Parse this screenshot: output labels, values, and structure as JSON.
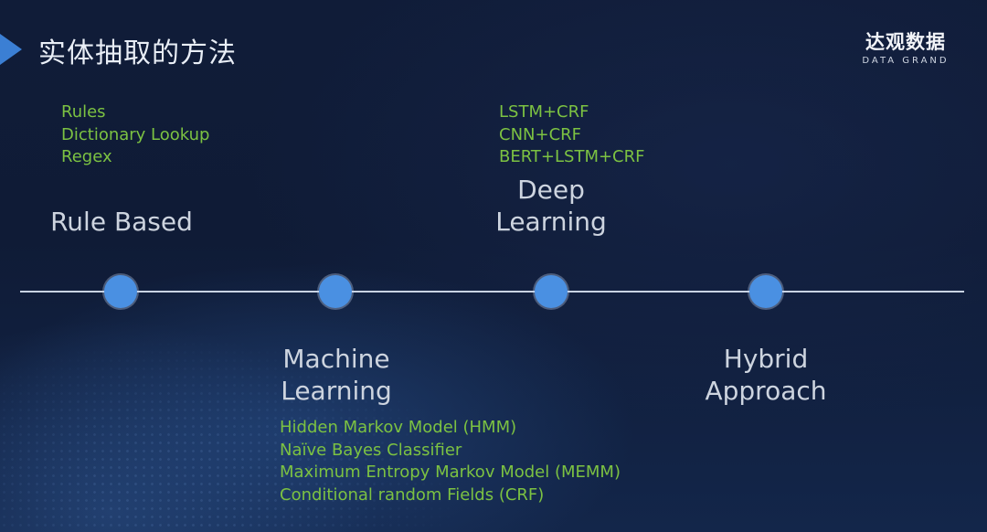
{
  "slide": {
    "title": "实体抽取的方法",
    "logo": {
      "name_cn": "达观数据",
      "name_en": "DATA GRAND"
    }
  },
  "colors": {
    "background": "#0f1b36",
    "node": "#4a90e2",
    "line": "#c9d3e3",
    "label": "#cdd4df",
    "methods": "#7cc242",
    "title_marker": "#3b7fd4"
  },
  "timeline": {
    "stages": [
      {
        "label_lines": [
          "Rule Based"
        ],
        "methods": [
          "Rules",
          "Dictionary Lookup",
          "Regex"
        ]
      },
      {
        "label_lines": [
          "Machine",
          "Learning"
        ],
        "methods": [
          "Hidden Markov Model (HMM)",
          "Naïve Bayes Classifier",
          "Maximum Entropy Markov Model (MEMM)",
          "Conditional random Fields (CRF)"
        ]
      },
      {
        "label_lines": [
          "Deep",
          "Learning"
        ],
        "methods": [
          "LSTM+CRF",
          "CNN+CRF",
          "BERT+LSTM+CRF"
        ]
      },
      {
        "label_lines": [
          "Hybrid",
          "Approach"
        ],
        "methods": []
      }
    ]
  }
}
